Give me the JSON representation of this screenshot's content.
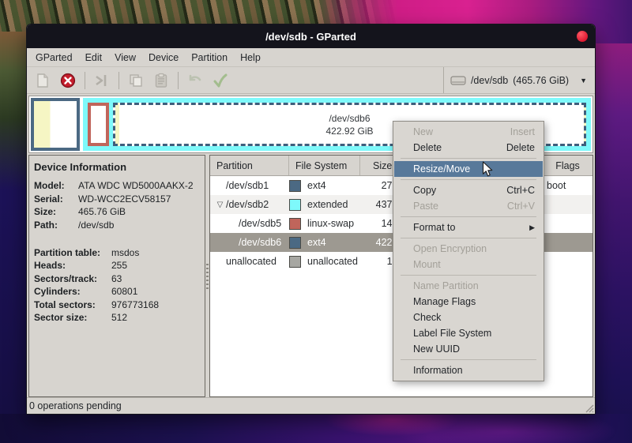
{
  "window": {
    "title": "/dev/sdb - GParted"
  },
  "menubar": {
    "items": [
      "GParted",
      "Edit",
      "View",
      "Device",
      "Partition",
      "Help"
    ]
  },
  "toolbar": {
    "device_selector": {
      "device": "/dev/sdb",
      "size": "(465.76 GiB)"
    }
  },
  "disk_visual": {
    "selected_label": "/dev/sdb6",
    "selected_size": "422.92 GiB"
  },
  "device_info": {
    "title": "Device Information",
    "fields": [
      {
        "label": "Model:",
        "value": "ATA WDC WD5000AAKX-2"
      },
      {
        "label": "Serial:",
        "value": "WD-WCC2ECV58157"
      },
      {
        "label": "Size:",
        "value": "465.76 GiB"
      },
      {
        "label": "Path:",
        "value": "/dev/sdb"
      },
      {
        "label": "Partition table:",
        "value": "msdos"
      },
      {
        "label": "Heads:",
        "value": "255"
      },
      {
        "label": "Sectors/track:",
        "value": "63"
      },
      {
        "label": "Cylinders:",
        "value": "60801"
      },
      {
        "label": "Total sectors:",
        "value": "976773168"
      },
      {
        "label": "Sector size:",
        "value": "512"
      }
    ]
  },
  "partition_table": {
    "headers": {
      "partition": "Partition",
      "file_system": "File System",
      "size": "Size",
      "flags": "Flags"
    },
    "rows": [
      {
        "name": "/dev/sdb1",
        "fs": "ext4",
        "size": "27.",
        "flags": "boot",
        "swatch_style": "background:#4b6983"
      },
      {
        "name": "/dev/sdb2",
        "fs": "extended",
        "size": "437.",
        "flags": "",
        "swatch_style": "background:#7ef9fb"
      },
      {
        "name": "/dev/sdb5",
        "fs": "linux-swap",
        "size": "14.",
        "flags": "",
        "swatch_style": "background:#c0655b"
      },
      {
        "name": "/dev/sdb6",
        "fs": "ext4",
        "size": "422.",
        "flags": "",
        "swatch_style": "background:#4b6983"
      },
      {
        "name": "unallocated",
        "fs": "unallocated",
        "size": "1.",
        "flags": "",
        "swatch_style": "background:#a7a7a2"
      }
    ]
  },
  "context_menu": {
    "items": [
      {
        "label": "New",
        "accel": "Insert"
      },
      {
        "label": "Delete",
        "accel": "Delete"
      },
      {
        "label": "Resize/Move",
        "accel": ""
      },
      {
        "label": "Copy",
        "accel": "Ctrl+C"
      },
      {
        "label": "Paste",
        "accel": "Ctrl+V"
      },
      {
        "label": "Format to",
        "accel": "▶"
      },
      {
        "label": "Open Encryption",
        "accel": ""
      },
      {
        "label": "Mount",
        "accel": ""
      },
      {
        "label": "Name Partition",
        "accel": ""
      },
      {
        "label": "Manage Flags",
        "accel": ""
      },
      {
        "label": "Check",
        "accel": ""
      },
      {
        "label": "Label File System",
        "accel": ""
      },
      {
        "label": "New UUID",
        "accel": ""
      },
      {
        "label": "Information",
        "accel": ""
      }
    ]
  },
  "statusbar": {
    "text": "0 operations pending"
  },
  "icons": {
    "combo_arrow": "▼",
    "expander_open": "▽"
  },
  "colors": {
    "selection_blue": "#58799a",
    "ext4": "#4b6983",
    "extended_cyan": "#7ef9fb",
    "linux_swap": "#c0655b",
    "unallocated_gray": "#a7a7a2",
    "titlebar": "#14141c",
    "close_red": "#dc1830",
    "window_gray": "#d7d4cf"
  }
}
